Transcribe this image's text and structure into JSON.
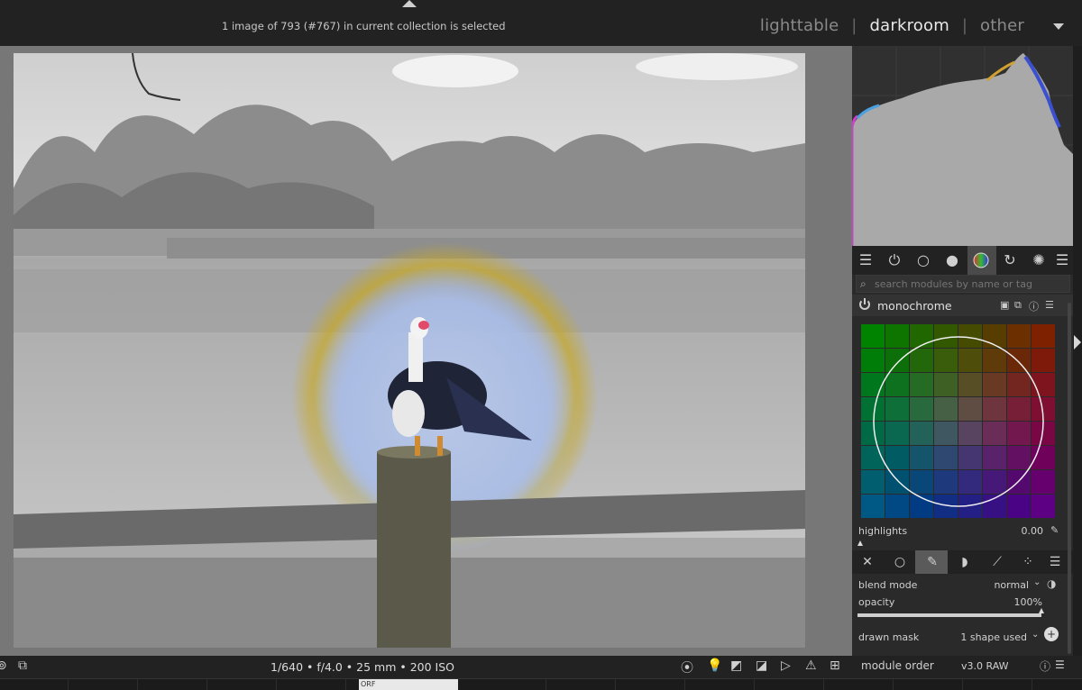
{
  "header": {
    "status": "1 image of 793 (#767) in current collection is selected",
    "views": [
      {
        "label": "lighttable",
        "active": false
      },
      {
        "label": "darkroom",
        "active": true
      },
      {
        "label": "other",
        "active": false
      }
    ],
    "separator": "|"
  },
  "module_groups": {
    "icons": [
      "quick-access-icon",
      "active-modules-icon",
      "base-group-icon",
      "tone-group-icon",
      "color-group-icon",
      "correct-group-icon",
      "effect-group-icon",
      "presets-menu-icon"
    ],
    "active": "color-group-icon"
  },
  "search": {
    "placeholder": "search modules by name or tag"
  },
  "module": {
    "name": "monochrome",
    "params": {
      "highlights_label": "highlights",
      "highlights_value": "0.00"
    }
  },
  "blend": {
    "tabs": [
      "off",
      "uniformly",
      "drawn mask",
      "parametric mask",
      "drawn & parametric mask",
      "raster mask"
    ],
    "active_tab": "drawn mask",
    "blend_mode_label": "blend mode",
    "blend_mode_value": "normal",
    "opacity_label": "opacity",
    "opacity_value": "100%",
    "opacity_fraction": 1.0,
    "drawn_mask_label": "drawn mask",
    "drawn_mask_value": "1 shape used"
  },
  "bottombar": {
    "exif": "1/640 • f/4.0 • 25 mm • 200 ISO",
    "module_order_label": "module order",
    "module_order_value": "v3.0 RAW"
  },
  "filmstrip": {
    "thumb_label": "ORF"
  },
  "colors": {
    "accent": "#e8e8e8",
    "panel_bg": "#2a2a2a",
    "center_bg": "#777777"
  }
}
